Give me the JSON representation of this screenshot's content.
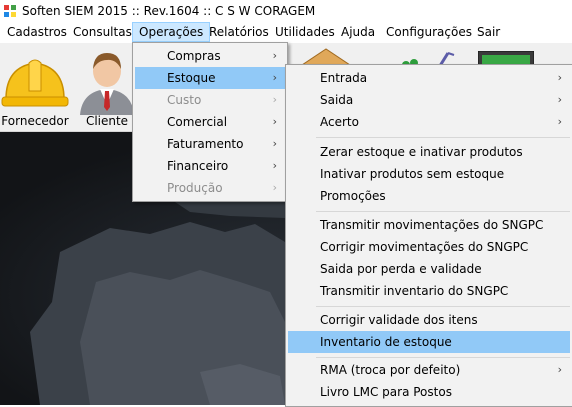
{
  "window": {
    "title": "Soften SIEM 2015 :: Rev.1604 :: C S W CORAGEM"
  },
  "menubar": {
    "items": [
      "Cadastros",
      "Consultas",
      "Operações",
      "Relatórios",
      "Utilidades",
      "Ajuda",
      "Configurações",
      "Sair"
    ]
  },
  "toolbar": {
    "buttons": [
      {
        "label": "Fornecedor",
        "icon": "hard-hat-icon"
      },
      {
        "label": "Cliente",
        "icon": "person-icon"
      }
    ]
  },
  "operacoes_menu": {
    "items": [
      {
        "label": "Compras",
        "enabled": true,
        "submenu": true
      },
      {
        "label": "Estoque",
        "enabled": true,
        "submenu": true,
        "highlighted": true
      },
      {
        "label": "Custo",
        "enabled": false,
        "submenu": true
      },
      {
        "label": "Comercial",
        "enabled": true,
        "submenu": true
      },
      {
        "label": "Faturamento",
        "enabled": true,
        "submenu": true
      },
      {
        "label": "Financeiro",
        "enabled": true,
        "submenu": true
      },
      {
        "label": "Produção",
        "enabled": false,
        "submenu": true
      }
    ]
  },
  "estoque_submenu": {
    "groups": [
      [
        "Entrada",
        "Saida",
        "Acerto"
      ],
      [
        "Zerar estoque e inativar produtos",
        "Inativar produtos sem estoque",
        "Promoções"
      ],
      [
        "Transmitir movimentações do SNGPC",
        "Corrigir movimentações do SNGPC",
        "Saida por perda e validade",
        "Transmitir inventario do SNGPC"
      ],
      [
        "Corrigir validade dos itens",
        "Inventario de estoque"
      ],
      [
        "RMA (troca por defeito)",
        "Livro LMC para Postos"
      ]
    ],
    "highlighted": "Inventario de estoque",
    "with_submenu": [
      "Entrada",
      "Saida",
      "Acerto",
      "RMA (troca por defeito)"
    ]
  },
  "colors": {
    "menu_highlight": "#91c9f7",
    "menubar_active": "#cce8ff",
    "desktop": "#17191c"
  }
}
